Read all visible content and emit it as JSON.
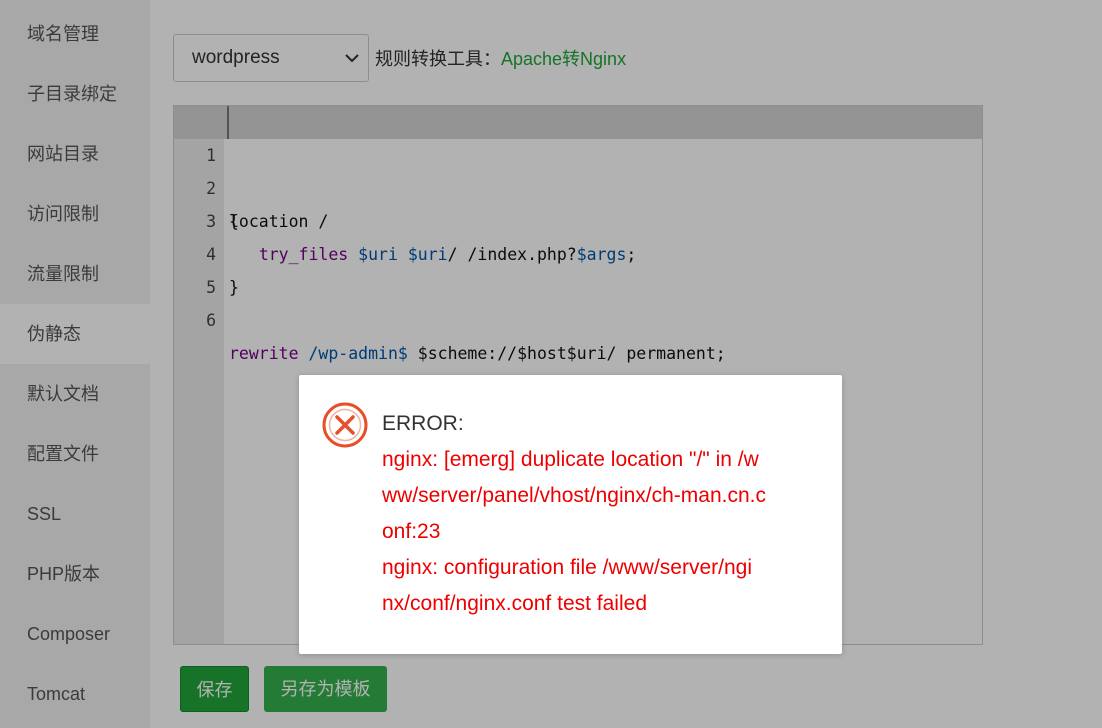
{
  "sidebar": {
    "items": [
      {
        "label": "域名管理"
      },
      {
        "label": "子目录绑定"
      },
      {
        "label": "网站目录"
      },
      {
        "label": "访问限制"
      },
      {
        "label": "流量限制"
      },
      {
        "label": "伪静态",
        "active": true
      },
      {
        "label": "默认文档"
      },
      {
        "label": "配置文件"
      },
      {
        "label": "SSL"
      },
      {
        "label": "PHP版本"
      },
      {
        "label": "Composer"
      },
      {
        "label": "Tomcat"
      }
    ]
  },
  "toolbar": {
    "template_select": {
      "value": "wordpress"
    },
    "tool_label": "规则转换工具：",
    "tool_link": "Apache转Nginx"
  },
  "editor": {
    "line_numbers": [
      "1",
      "2",
      "3",
      "4",
      "5",
      "6"
    ]
  },
  "actions": {
    "save_label": "保存",
    "save_template_label": "另存为模板"
  },
  "dialog": {
    "title": "ERROR:",
    "message": "nginx: [emerg] duplicate location \"/\" in /www/server/panel/vhost/nginx/ch-man.cn.conf:23\nnginx: configuration file /www/server/nginx/conf/nginx.conf test failed",
    "message_lines": [
      "nginx: [emerg] duplicate location \"/\" in /w",
      "ww/server/panel/vhost/nginx/ch-man.cn.c",
      "onf:23",
      "nginx: configuration file /www/server/ngi",
      "nx/conf/nginx.conf test failed"
    ],
    "icon": "error-circle-icon"
  },
  "colors": {
    "accent_green": "#20a53a",
    "error_red": "#ee0000",
    "error_icon": "#e5502b"
  }
}
